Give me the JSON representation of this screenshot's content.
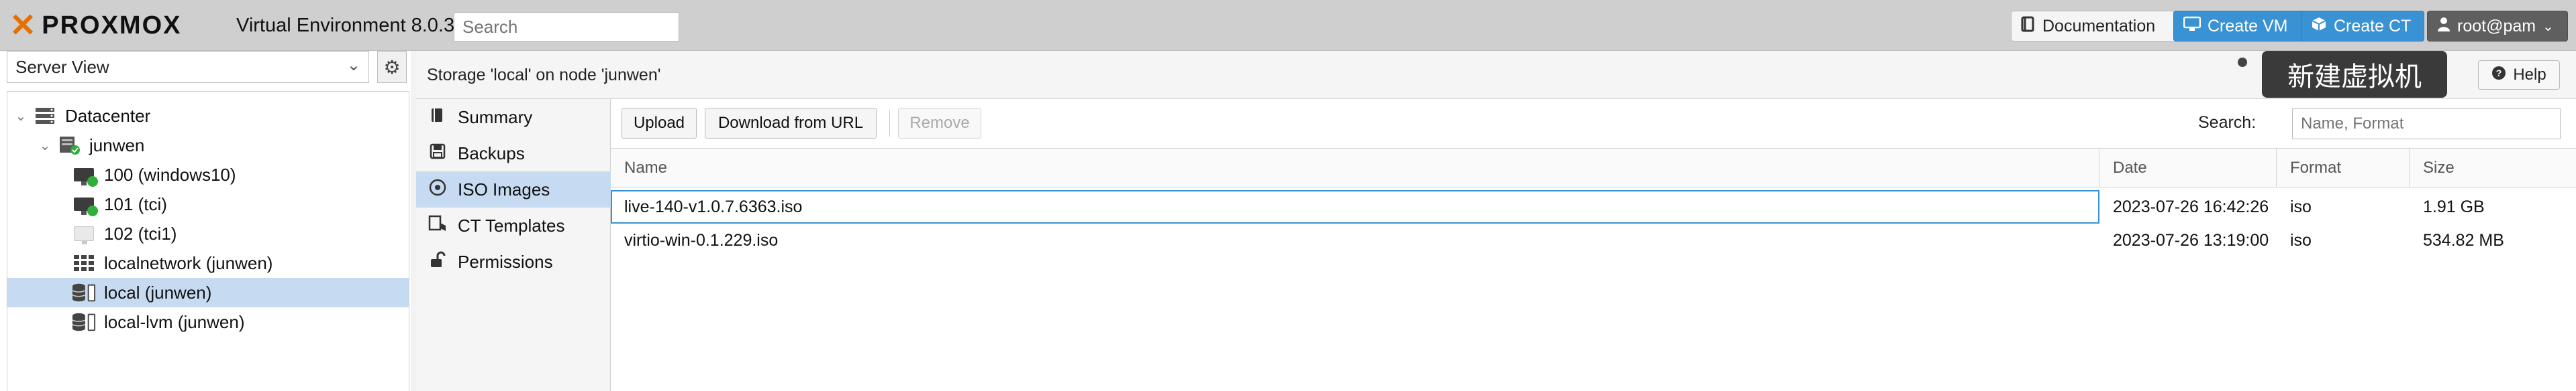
{
  "header": {
    "logo": "PROXMOX",
    "version": "Virtual Environment 8.0.3",
    "search_placeholder": "Search",
    "doc_label": "Documentation",
    "create_vm_label": "Create VM",
    "create_ct_label": "Create CT",
    "user_label": "root@pam"
  },
  "sidebar": {
    "view": "Server View",
    "tree": [
      {
        "label": "Datacenter",
        "icon": "datacenter-icon"
      },
      {
        "label": "junwen",
        "icon": "node-icon"
      },
      {
        "label": "100 (windows10)",
        "icon": "vm-running-icon"
      },
      {
        "label": "101 (tci)",
        "icon": "vm-running-icon"
      },
      {
        "label": "102 (tci1)",
        "icon": "vm-stopped-icon"
      },
      {
        "label": "localnetwork (junwen)",
        "icon": "network-icon"
      },
      {
        "label": "local (junwen)",
        "icon": "storage-icon",
        "selected": true
      },
      {
        "label": "local-lvm (junwen)",
        "icon": "storage-icon"
      }
    ]
  },
  "content": {
    "title": "Storage 'local' on node 'junwen'",
    "help_label": "Help",
    "tooltip": "新建虚拟机",
    "nav": [
      {
        "label": "Summary",
        "icon": "book-icon"
      },
      {
        "label": "Backups",
        "icon": "floppy-icon"
      },
      {
        "label": "ISO Images",
        "icon": "disc-icon",
        "active": true
      },
      {
        "label": "CT Templates",
        "icon": "template-icon"
      },
      {
        "label": "Permissions",
        "icon": "unlock-icon"
      }
    ],
    "toolbar": {
      "upload": "Upload",
      "download_url": "Download from URL",
      "remove": "Remove",
      "search_label": "Search:",
      "search_placeholder": "Name, Format"
    },
    "table": {
      "columns": [
        "Name",
        "Date",
        "Format",
        "Size"
      ],
      "rows": [
        [
          "live-140-v1.0.7.6363.iso",
          "2023-07-26 16:42:26",
          "iso",
          "1.91 GB"
        ],
        [
          "virtio-win-0.1.229.iso",
          "2023-07-26 13:19:00",
          "iso",
          "534.82 MB"
        ]
      ]
    }
  },
  "colors": {
    "accent": "#3892d3",
    "selection": "#c6dbf2",
    "logo_orange": "#e57000"
  }
}
